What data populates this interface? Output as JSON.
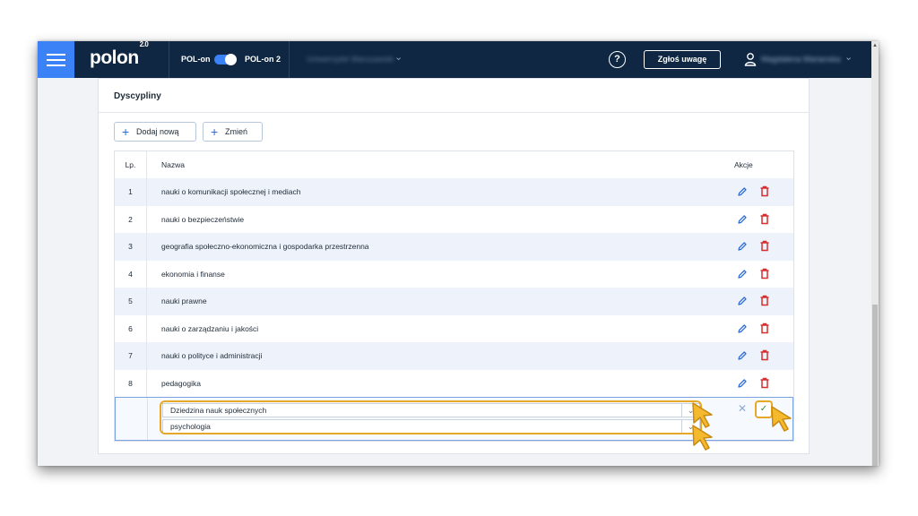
{
  "topbar": {
    "logo": "polon",
    "logo_version": "2.0",
    "pol_on_label": "POL-on",
    "pol_on2_label": "POL-on 2",
    "university": "Uniwersytet Warszawski",
    "help_label": "?",
    "report_label": "Zgłoś uwagę",
    "user_name": "Magdalena Marianska"
  },
  "panel": {
    "title": "Dyscypliny",
    "add_label": "Dodaj nową",
    "change_label": "Zmień"
  },
  "table": {
    "headers": {
      "lp": "Lp.",
      "name": "Nazwa",
      "actions": "Akcje"
    },
    "rows": [
      {
        "lp": "1",
        "name": "nauki o komunikacji społecznej i mediach"
      },
      {
        "lp": "2",
        "name": "nauki o bezpieczeństwie"
      },
      {
        "lp": "3",
        "name": "geografia społeczno-ekonomiczna i gospodarka przestrzenna"
      },
      {
        "lp": "4",
        "name": "ekonomia i finanse"
      },
      {
        "lp": "5",
        "name": "nauki prawne"
      },
      {
        "lp": "6",
        "name": "nauki o zarządzaniu i jakości"
      },
      {
        "lp": "7",
        "name": "nauki o polityce i administracji"
      },
      {
        "lp": "8",
        "name": "pedagogika"
      }
    ],
    "edit_row": {
      "domain_value": "Dziedzina nauk społecznych",
      "discipline_value": "psychologia"
    }
  },
  "colors": {
    "topbar": "#0f2742",
    "accent": "#3b82f6",
    "highlight": "#e8a827",
    "delete": "#d62d2d"
  },
  "icons": [
    "menu-icon",
    "chevron-down-icon",
    "help-icon",
    "user-icon",
    "plus-icon",
    "pencil-icon",
    "trash-icon",
    "close-icon",
    "check-icon",
    "cursor-pointer-icon"
  ]
}
